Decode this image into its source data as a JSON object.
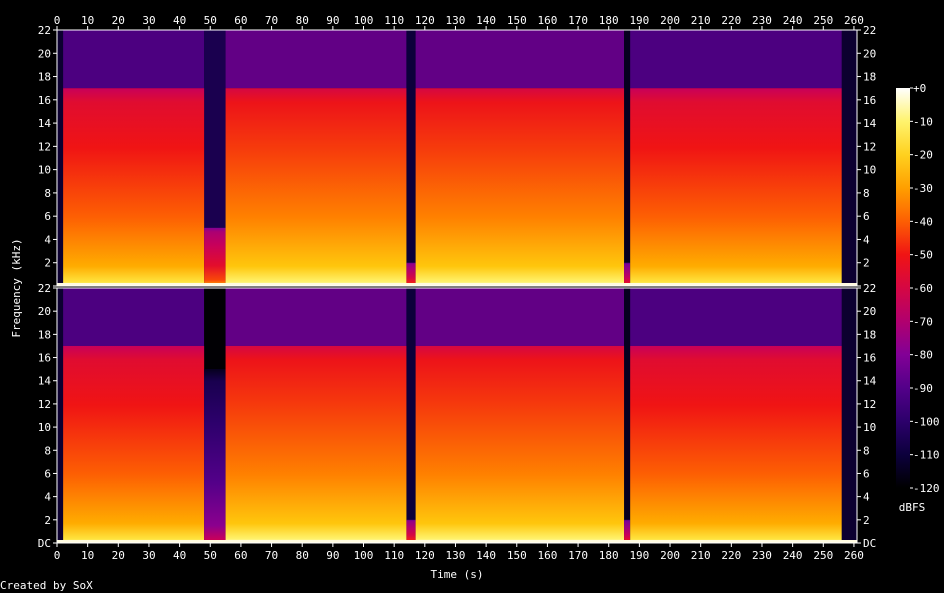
{
  "chart_data": {
    "type": "heatmap",
    "title": "",
    "xlabel": "Time (s)",
    "ylabel": "Frequency (kHz)",
    "xlim": [
      0,
      261
    ],
    "ylim": [
      0,
      22
    ],
    "x_ticks": [
      0,
      10,
      20,
      30,
      40,
      50,
      60,
      70,
      80,
      90,
      100,
      110,
      120,
      130,
      140,
      150,
      160,
      170,
      180,
      190,
      200,
      210,
      220,
      230,
      240,
      250,
      260
    ],
    "y_ticks": [
      "DC",
      "2",
      "4",
      "6",
      "8",
      "10",
      "12",
      "14",
      "16",
      "18",
      "20",
      "22"
    ],
    "y_ticks_top_channel": [
      "22",
      "2",
      "4",
      "6",
      "8",
      "10",
      "12",
      "14",
      "16",
      "18",
      "20",
      "22"
    ],
    "colorbar": {
      "label": "dBFS",
      "ticks": [
        "+0",
        "-10",
        "-20",
        "-30",
        "-40",
        "-50",
        "-60",
        "-70",
        "-80",
        "-90",
        "-100",
        "-110",
        "-120"
      ],
      "range": [
        -120,
        0
      ]
    },
    "channels": [
      {
        "name": "",
        "segments": [
          {
            "start": 2,
            "end": 48,
            "top_khz": 17,
            "level_db": -50
          },
          {
            "start": 48,
            "end": 55,
            "top_khz": 5,
            "level_db": -65
          },
          {
            "start": 55,
            "end": 114,
            "top_khz": 17,
            "level_db": -45
          },
          {
            "start": 114,
            "end": 117,
            "top_khz": 2,
            "level_db": -70
          },
          {
            "start": 117,
            "end": 185,
            "top_khz": 17,
            "level_db": -45
          },
          {
            "start": 185,
            "end": 187,
            "top_khz": 2,
            "level_db": -75
          },
          {
            "start": 187,
            "end": 256,
            "top_khz": 17,
            "level_db": -50
          }
        ]
      },
      {
        "name": "",
        "segments": [
          {
            "start": 2,
            "end": 48,
            "top_khz": 17,
            "level_db": -50
          },
          {
            "start": 48,
            "end": 55,
            "top_khz": 15,
            "level_db": -100
          },
          {
            "start": 55,
            "end": 114,
            "top_khz": 17,
            "level_db": -45
          },
          {
            "start": 114,
            "end": 117,
            "top_khz": 2,
            "level_db": -70
          },
          {
            "start": 117,
            "end": 185,
            "top_khz": 17,
            "level_db": -45
          },
          {
            "start": 185,
            "end": 187,
            "top_khz": 2,
            "level_db": -75
          },
          {
            "start": 187,
            "end": 256,
            "top_khz": 17,
            "level_db": -50
          }
        ]
      }
    ]
  },
  "footer": {
    "credit": "Created by SoX"
  }
}
